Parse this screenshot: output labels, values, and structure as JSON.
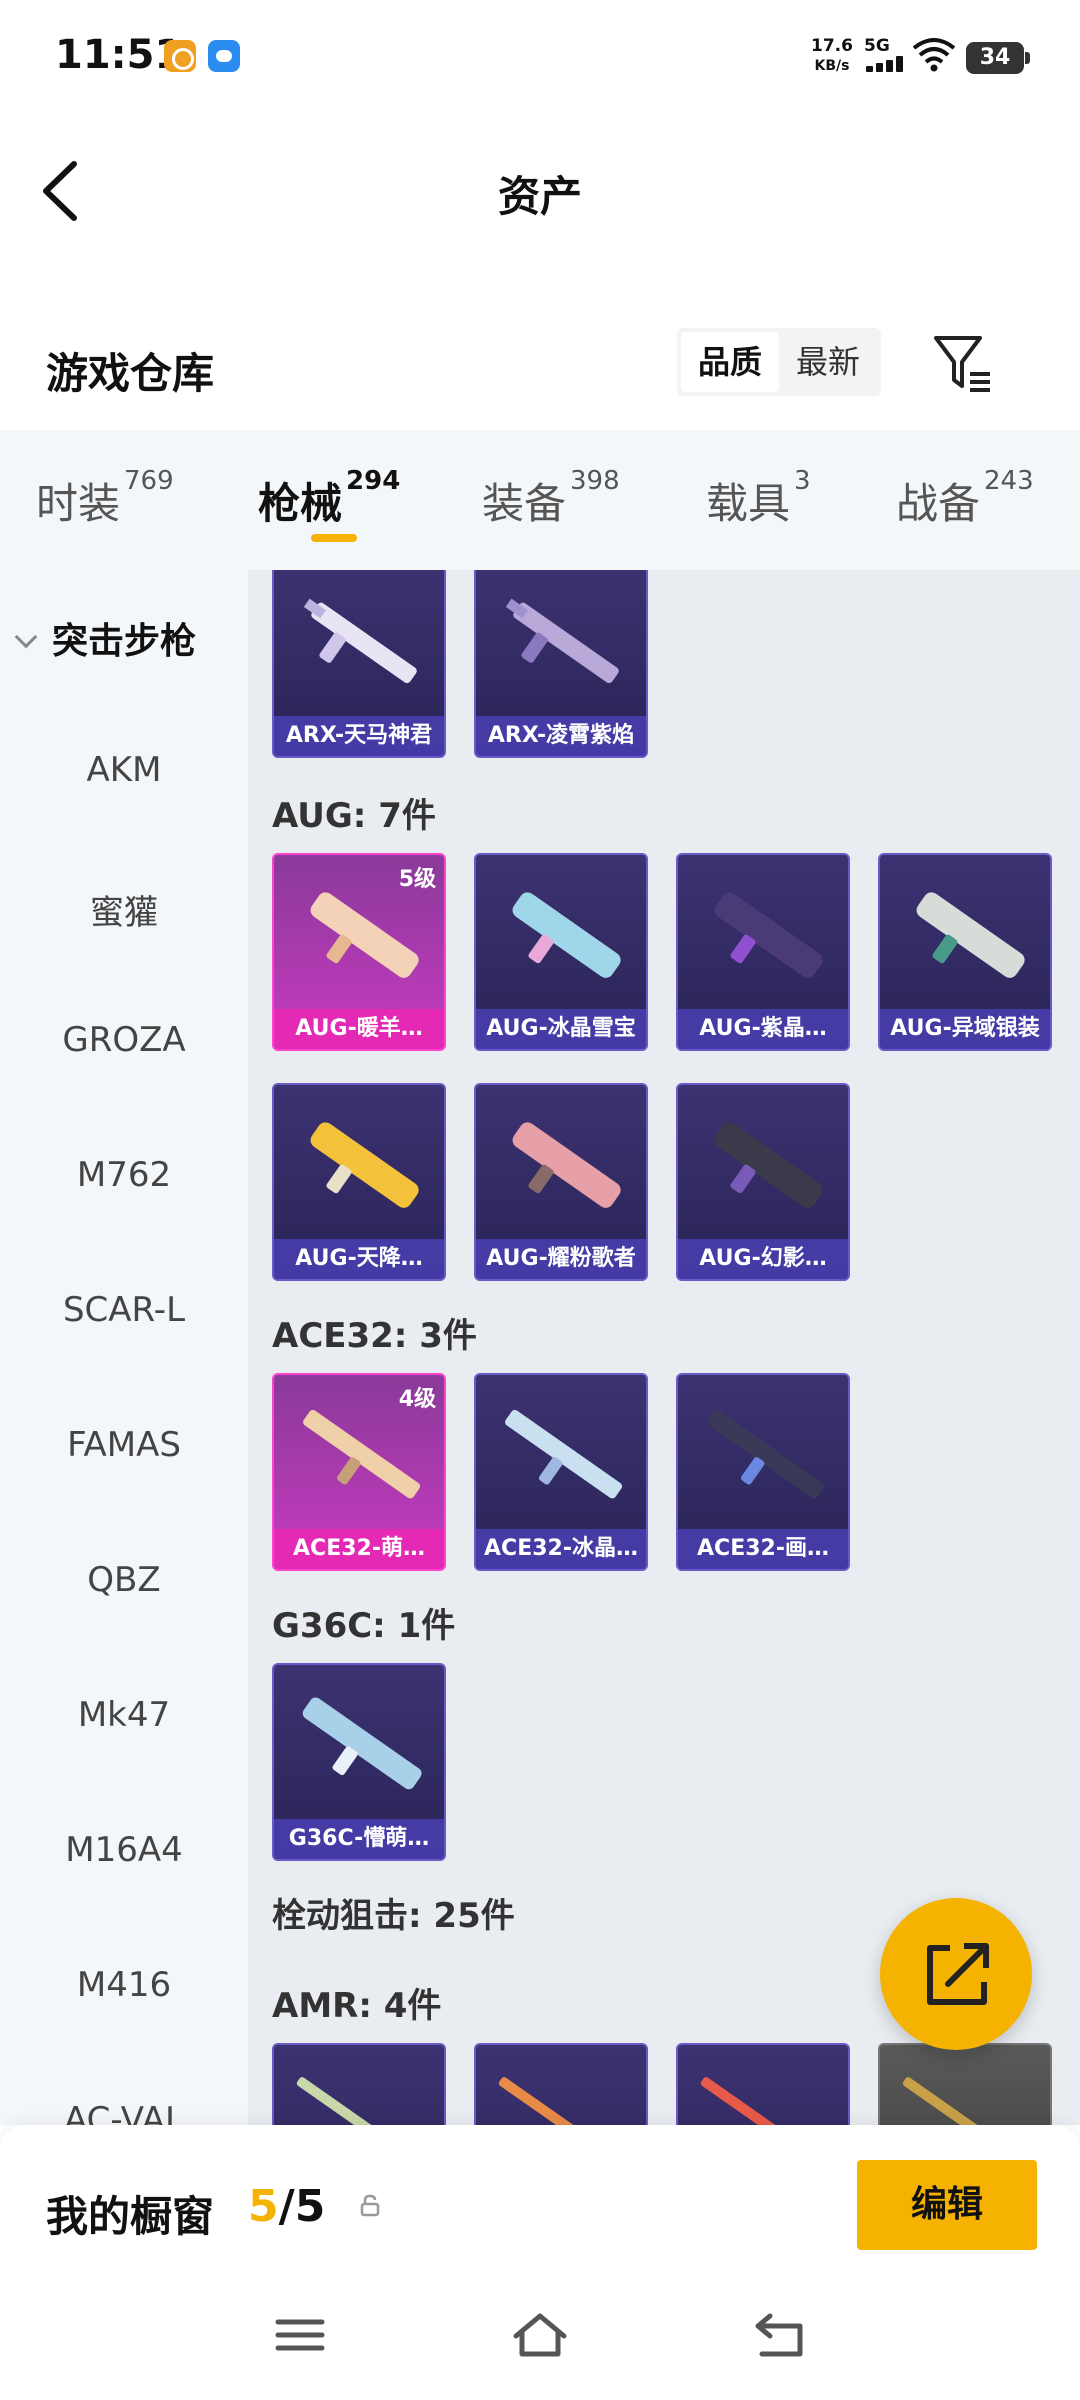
{
  "status_bar": {
    "time": "11:51",
    "net_speed": "17.6",
    "net_unit": "KB/s",
    "network": "5G",
    "battery": "34"
  },
  "header": {
    "title": "资产"
  },
  "warehouse": {
    "title": "游戏仓库",
    "sort_options": [
      "品质",
      "最新"
    ],
    "sort_selected": "品质"
  },
  "tabs": [
    {
      "label": "时装",
      "count": "769"
    },
    {
      "label": "枪械",
      "count": "294"
    },
    {
      "label": "装备",
      "count": "398"
    },
    {
      "label": "载具",
      "count": "3"
    },
    {
      "label": "战备",
      "count": "243"
    }
  ],
  "active_tab": "枪械",
  "sidebar": {
    "category": "突击步枪",
    "items": [
      "AKM",
      "蜜獾",
      "GROZA",
      "M762",
      "SCAR-L",
      "FAMAS",
      "QBZ",
      "Mk47",
      "M16A4",
      "M416",
      "AC-VAL"
    ]
  },
  "content": {
    "arx_items": [
      {
        "name": "ARX-天马神君"
      },
      {
        "name": "ARX-凌霄紫焰"
      }
    ],
    "aug_label": "AUG: 7件",
    "aug_items": [
      {
        "name": "AUG-暖羊…",
        "level": "5级"
      },
      {
        "name": "AUG-冰晶雪宝"
      },
      {
        "name": "AUG-紫晶…"
      },
      {
        "name": "AUG-异域银装"
      },
      {
        "name": "AUG-天降…"
      },
      {
        "name": "AUG-耀粉歌者"
      },
      {
        "name": "AUG-幻影…"
      }
    ],
    "ace_label": "ACE32: 3件",
    "ace_items": [
      {
        "name": "ACE32-萌…",
        "level": "4级"
      },
      {
        "name": "ACE32-冰晶…"
      },
      {
        "name": "ACE32-画…"
      }
    ],
    "g36_label": "G36C: 1件",
    "g36_items": [
      {
        "name": "G36C-懵萌…"
      }
    ],
    "sniper_label": "栓动狙击: 25件",
    "amr_label": "AMR: 4件"
  },
  "bottom": {
    "showcase_label": "我的橱窗",
    "current": "5",
    "separator": "/",
    "total": "5",
    "edit_label": "编辑"
  },
  "colors": {
    "accent": "#f5b200",
    "card_purple": "#3c3272",
    "card_gold": "#c83ac0"
  }
}
